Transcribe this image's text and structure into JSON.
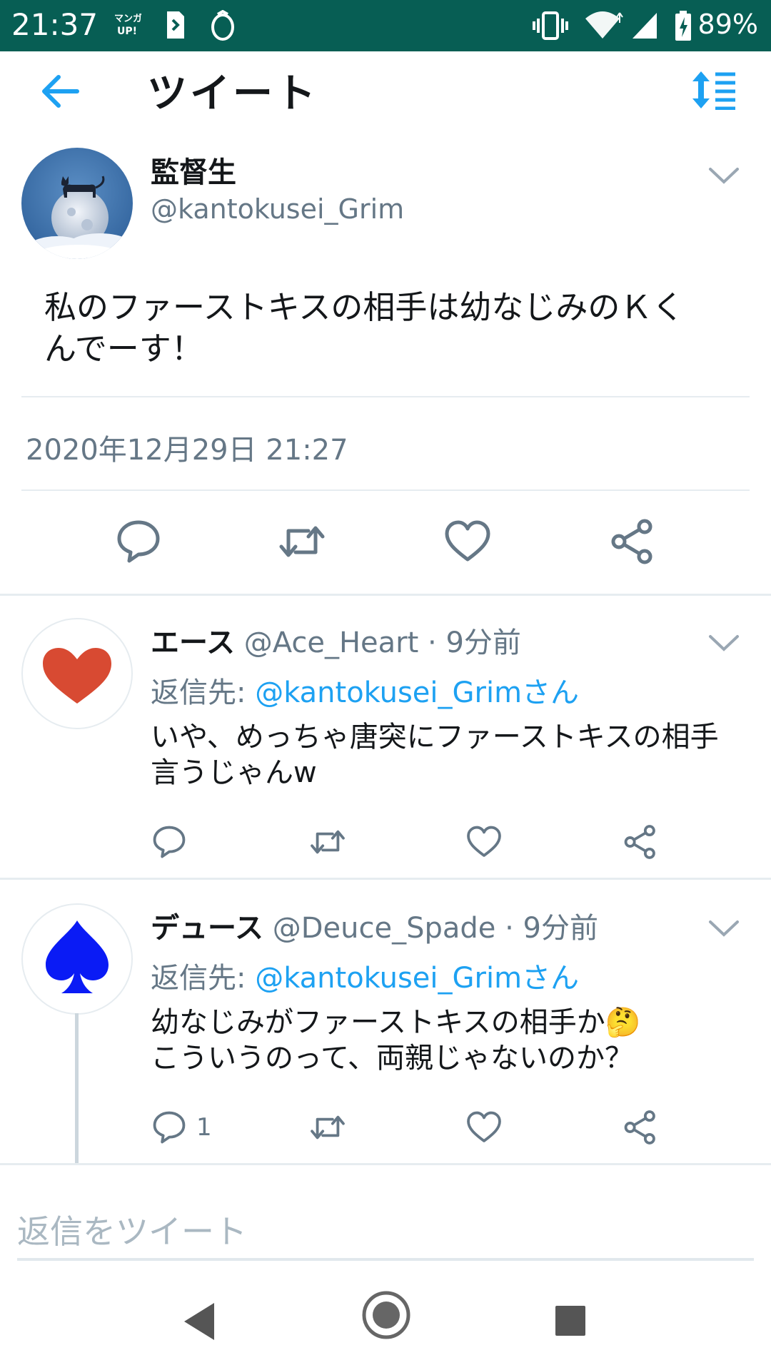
{
  "status_bar": {
    "time": "21:37",
    "notification_icons": [
      "manga-up-icon",
      "document-icon",
      "ring-icon"
    ],
    "system_icons": [
      "vibrate-icon",
      "wifi-icon",
      "signal-icon",
      "battery-charging-icon"
    ],
    "battery": "89%"
  },
  "app_bar": {
    "title": "ツイート",
    "back_icon": "arrow-left-icon",
    "sort_icon": "sort-icon"
  },
  "main_tweet": {
    "display_name": "監督生",
    "handle": "@kantokusei_Grim",
    "text_line1": "私のファーストキスの相手は幼なじみのＫく",
    "text_line2": "んでーす！",
    "timestamp": "2020年12月29日 21:27",
    "actions": [
      "reply-icon",
      "retweet-icon",
      "like-icon",
      "share-icon"
    ]
  },
  "replies": [
    {
      "display_name": "エース",
      "meta": "@Ace_Heart · 9分前",
      "reply_to_label": "返信先: ",
      "reply_to_mention": "@kantokusei_Grimさん",
      "text_line1": "いや、めっちゃ唐突にファーストキスの相手",
      "text_line2": "言うじゃんw",
      "reply_count": "",
      "avatar_color": "#d84a32"
    },
    {
      "display_name": "デュース",
      "meta": "@Deuce_Spade · 9分前",
      "reply_to_label": "返信先: ",
      "reply_to_mention": "@kantokusei_Grimさん",
      "text_line1": "幼なじみがファーストキスの相手か🤔",
      "text_line2": "こういうのって、両親じゃないのか？",
      "reply_count": "1",
      "avatar_color": "#0a1bf5"
    }
  ],
  "composer": {
    "placeholder": "返信をツイート"
  },
  "nav_bar": {
    "buttons": [
      "back-triangle-icon",
      "home-circle-icon",
      "recents-square-icon"
    ]
  },
  "colors": {
    "status_bar": "#075e54",
    "accent": "#1da1f2",
    "secondary_text": "#657786",
    "icon_gray": "#657786"
  }
}
